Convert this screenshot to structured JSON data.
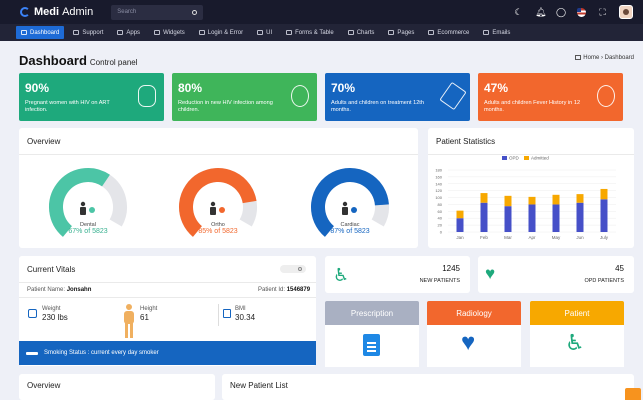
{
  "app": {
    "logo_bold": "Medi",
    "logo_rest": "Admin"
  },
  "search": {
    "placeholder": "Search"
  },
  "nav": [
    "Dashboard",
    "Support",
    "Apps",
    "Widgets",
    "Login & Error",
    "UI",
    "Forms & Table",
    "Charts",
    "Pages",
    "Ecommerce",
    "Emails"
  ],
  "page": {
    "title": "Dashboard",
    "subtitle": "Control panel",
    "crumb_home": "Home",
    "crumb_sep": "›",
    "crumb_current": "Dashboard"
  },
  "stats": [
    {
      "value": "90%",
      "text": "Pregnant women with HIV on ART infection.",
      "color": "#1ea97c"
    },
    {
      "value": "80%",
      "text": "Reduction in new HIV infection among children.",
      "color": "#3fb55a"
    },
    {
      "value": "70%",
      "text": "Adults and children on treatment 12th months.",
      "color": "#1565c0"
    },
    {
      "value": "47%",
      "text": "Adults and children Fever History in 12 months.",
      "color": "#f2672d"
    }
  ],
  "overview": {
    "title": "Overview",
    "gauges": [
      {
        "label": "Dental",
        "value": "67% of 5823",
        "fraction": 0.67,
        "color": "#4cc5a6",
        "text_color": "#36b08f"
      },
      {
        "label": "Ortho",
        "value": "85% of 5823",
        "fraction": 0.85,
        "color": "#f2672d",
        "text_color": "#f2672d"
      },
      {
        "label": "Cardiac",
        "value": "87% of 5823",
        "fraction": 0.87,
        "color": "#1565c0",
        "text_color": "#1565c0"
      }
    ]
  },
  "patient_stats": {
    "title": "Patient Statistics",
    "chart_data": {
      "type": "bar",
      "stacked": true,
      "categories": [
        "Jan",
        "Feb",
        "Mar",
        "Apr",
        "May",
        "Jun",
        "July"
      ],
      "series": [
        {
          "name": "OPD",
          "color": "#4650c8",
          "values": [
            40,
            85,
            75,
            80,
            80,
            85,
            95
          ]
        },
        {
          "name": "Admitted",
          "color": "#f7a800",
          "values": [
            22,
            28,
            30,
            22,
            28,
            25,
            30
          ]
        }
      ],
      "ylim": [
        0,
        180
      ],
      "yticks": [
        0,
        20,
        40,
        60,
        80,
        100,
        120,
        140,
        160,
        180
      ],
      "legend": "top",
      "grid": true
    }
  },
  "vitals": {
    "title": "Current Vitals",
    "patient_name_label": "Patient Name:",
    "patient_name": "Jonsahn",
    "patient_id_label": "Patient Id:",
    "patient_id": "1546879",
    "weight_label": "Weight",
    "weight_value": "230 lbs",
    "height_label": "Height",
    "height_value": "61",
    "bmi_label": "BMI",
    "bmi_value": "30.34",
    "smoking": "Smoking Status : current every day smoker"
  },
  "new_patients": {
    "count": "1245",
    "label": "NEW PATIENTS"
  },
  "opd_patients": {
    "count": "45",
    "label": "OPD PATIENTS"
  },
  "buttons": [
    {
      "label": "Prescription",
      "color": "#a9b0c2"
    },
    {
      "label": "Radiology",
      "color": "#f2672d"
    },
    {
      "label": "Patient",
      "color": "#f7a800"
    }
  ],
  "bottom": {
    "left_title": "Overview",
    "right_title": "New Patient List"
  }
}
